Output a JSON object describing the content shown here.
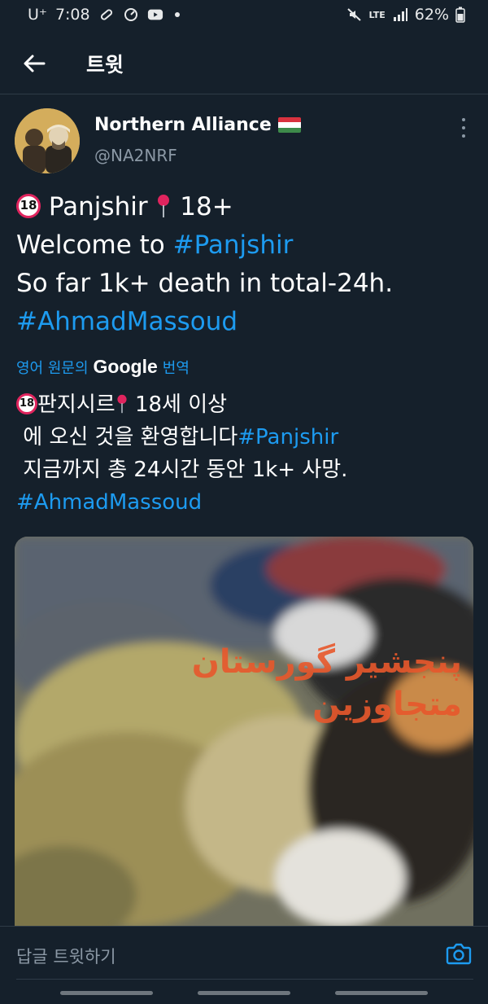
{
  "status_bar": {
    "carrier": "U⁺",
    "time": "7:08",
    "network": "LTE",
    "battery": "62%"
  },
  "app_bar": {
    "title": "트윗",
    "back_icon": "arrow-left-icon"
  },
  "tweet": {
    "author_name": "Northern Alliance",
    "flag": "hungary-flag",
    "handle": "@NA2NRF",
    "text": {
      "line1_word": "Panjshir",
      "line1_age": "18+",
      "line2_prefix": "Welcome to ",
      "line2_tag": "#Panjshir",
      "line3": "So far 1k+ death in total-24h.",
      "line4_tag": "#AhmadMassoud"
    },
    "badge_18": "18",
    "translate": {
      "prefix": "영어 원문의",
      "google": "Google",
      "suffix": "번역"
    },
    "translated": {
      "line1_text": "판지시르",
      "line1_rest": "18세 이상",
      "line2_text": "에 오신 것을 환영합니다",
      "line2_tag": "#Panjshir",
      "line3": "지금까지 총 24시간 동안 1k+ 사망.",
      "line4_tag": "#AhmadMassoud"
    },
    "media_overlay": "پنجشیر گورستان متجاوزین"
  },
  "reply_bar": {
    "placeholder": "답글 트윗하기",
    "camera_icon": "camera-icon"
  },
  "colors": {
    "background": "#15202b",
    "link": "#1d9bf0",
    "secondary_text": "#8b98a5"
  }
}
